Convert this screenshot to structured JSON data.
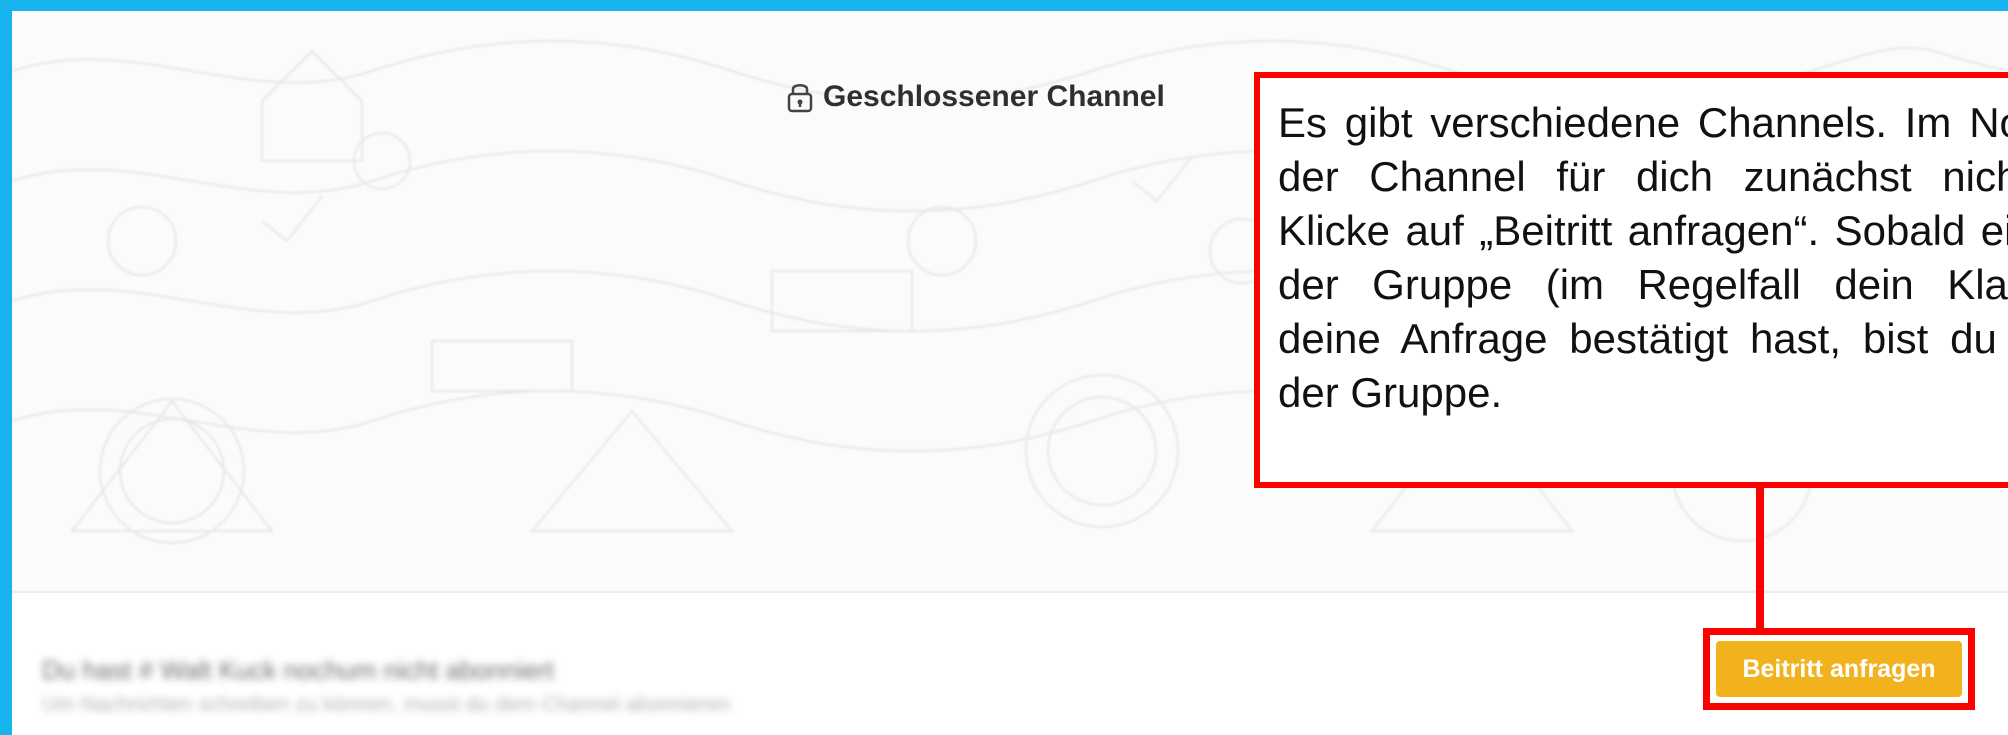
{
  "channel": {
    "lock_icon": "lock-icon",
    "title": "Geschlossener Channel"
  },
  "callout": {
    "text": "Es gibt verschiedene Channels. Im Normalfall ist der Channel für dich zunächst nicht sichtbar. Klicke auf „Beitritt anfragen“. Sobald ein Manager der Gruppe (im Regelfall dein Klassenlehrer) deine Anfrage bestätigt hast, bist du Mitglied in der Gruppe."
  },
  "notice": {
    "title": "Du hast # Walt Kuck nochum nicht abonniert",
    "subtitle": "Um Nachrichten schreiben zu können, musst du dem Channel abonnieren"
  },
  "actions": {
    "join_label": "Beitritt anfragen"
  },
  "colors": {
    "page_border": "#17b3ee",
    "highlight": "#ff0000",
    "button": "#f2b21e"
  }
}
